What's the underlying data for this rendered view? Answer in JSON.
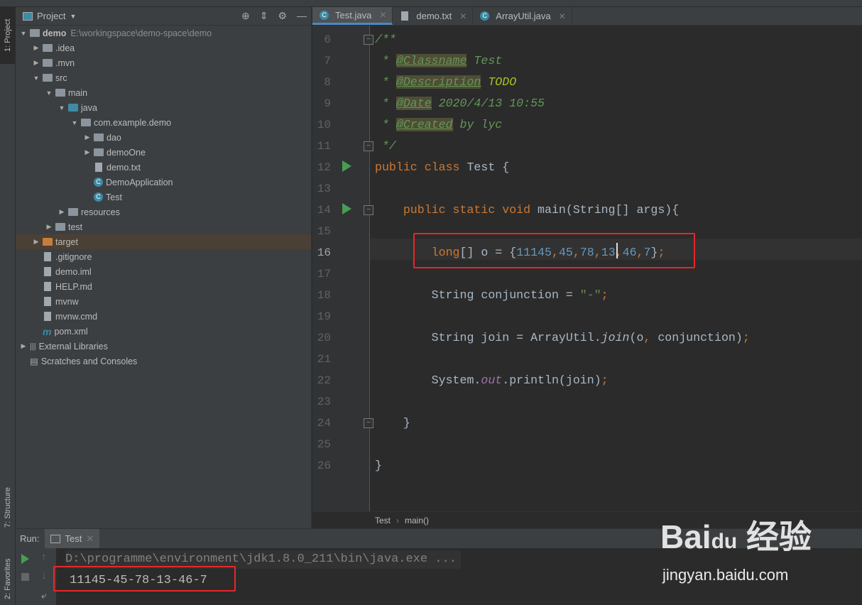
{
  "side_tabs": {
    "project": "1: Project",
    "structure": "7: Structure",
    "favorites": "2: Favorites"
  },
  "project_panel": {
    "title": "Project",
    "tree": [
      {
        "label": "demo",
        "path": "E:\\workingspace\\demo-space\\demo",
        "depth": 0,
        "expanded": true,
        "icon": "module-folder",
        "bold": true
      },
      {
        "label": ".idea",
        "depth": 1,
        "expanded": false,
        "icon": "folder"
      },
      {
        "label": ".mvn",
        "depth": 1,
        "expanded": false,
        "icon": "folder"
      },
      {
        "label": "src",
        "depth": 1,
        "expanded": true,
        "icon": "folder"
      },
      {
        "label": "main",
        "depth": 2,
        "expanded": true,
        "icon": "folder"
      },
      {
        "label": "java",
        "depth": 3,
        "expanded": true,
        "icon": "source-folder"
      },
      {
        "label": "com.example.demo",
        "depth": 4,
        "expanded": true,
        "icon": "package"
      },
      {
        "label": "dao",
        "depth": 5,
        "expanded": false,
        "icon": "package"
      },
      {
        "label": "demoOne",
        "depth": 5,
        "expanded": false,
        "icon": "package"
      },
      {
        "label": "demo.txt",
        "depth": 5,
        "icon": "file"
      },
      {
        "label": "DemoApplication",
        "depth": 5,
        "icon": "class"
      },
      {
        "label": "Test",
        "depth": 5,
        "icon": "class"
      },
      {
        "label": "resources",
        "depth": 3,
        "expanded": false,
        "icon": "folder"
      },
      {
        "label": "test",
        "depth": 2,
        "expanded": false,
        "icon": "folder"
      },
      {
        "label": "target",
        "depth": 1,
        "expanded": false,
        "icon": "excluded-folder",
        "selected": true
      },
      {
        "label": ".gitignore",
        "depth": 1,
        "icon": "file"
      },
      {
        "label": "demo.iml",
        "depth": 1,
        "icon": "file"
      },
      {
        "label": "HELP.md",
        "depth": 1,
        "icon": "file"
      },
      {
        "label": "mvnw",
        "depth": 1,
        "icon": "file"
      },
      {
        "label": "mvnw.cmd",
        "depth": 1,
        "icon": "file"
      },
      {
        "label": "pom.xml",
        "depth": 1,
        "icon": "maven"
      },
      {
        "label": "External Libraries",
        "depth": 0,
        "expanded": false,
        "icon": "library"
      },
      {
        "label": "Scratches and Consoles",
        "depth": 0,
        "icon": "scratch"
      }
    ]
  },
  "editor_tabs": [
    {
      "label": "Test.java",
      "active": true
    },
    {
      "label": "demo.txt"
    },
    {
      "label": "ArrayUtil.java"
    }
  ],
  "code_lines": [
    {
      "n": "6",
      "t": [
        [
          "cmt",
          "/**"
        ]
      ]
    },
    {
      "n": "7",
      "t": [
        [
          "cmt",
          " * "
        ],
        [
          "tag",
          "@Classname"
        ],
        [
          "cmt",
          " Test"
        ]
      ]
    },
    {
      "n": "8",
      "t": [
        [
          "cmt",
          " * "
        ],
        [
          "tag",
          "@Description"
        ],
        [
          "cmt",
          " "
        ],
        [
          "todo",
          "TODO"
        ]
      ]
    },
    {
      "n": "9",
      "t": [
        [
          "cmt",
          " * "
        ],
        [
          "tag",
          "@Date"
        ],
        [
          "cmt",
          " 2020/4/13 10:55"
        ]
      ]
    },
    {
      "n": "10",
      "t": [
        [
          "cmt",
          " * "
        ],
        [
          "tag",
          "@Created"
        ],
        [
          "cmt",
          " by lyc"
        ]
      ]
    },
    {
      "n": "11",
      "t": [
        [
          "cmt",
          " */"
        ]
      ]
    },
    {
      "n": "12",
      "t": [
        [
          "kw",
          "public class "
        ],
        [
          "",
          "Test {"
        ]
      ]
    },
    {
      "n": "13",
      "t": []
    },
    {
      "n": "14",
      "t": [
        [
          "",
          "    "
        ],
        [
          "kw",
          "public static void "
        ],
        [
          "",
          "main(String[] args){"
        ]
      ]
    },
    {
      "n": "15",
      "t": []
    },
    {
      "n": "16",
      "t": [
        [
          "",
          "        "
        ],
        [
          "kw",
          "long"
        ],
        [
          "",
          "[] o = {"
        ],
        [
          "num",
          "11145"
        ],
        [
          "kw",
          ","
        ],
        [
          "num",
          "45"
        ],
        [
          "kw",
          ","
        ],
        [
          "num",
          "78"
        ],
        [
          "kw",
          ","
        ],
        [
          "num",
          "13"
        ],
        [
          "kw",
          ","
        ],
        [
          "num",
          "46"
        ],
        [
          "kw",
          ","
        ],
        [
          "num",
          "7"
        ],
        [
          "",
          "}"
        ],
        [
          "kw",
          ";"
        ]
      ]
    },
    {
      "n": "17",
      "t": []
    },
    {
      "n": "18",
      "t": [
        [
          "",
          "        String conjunction = "
        ],
        [
          "str",
          "\"-\""
        ],
        [
          "kw",
          ";"
        ]
      ]
    },
    {
      "n": "19",
      "t": []
    },
    {
      "n": "20",
      "t": [
        [
          "",
          "        String join = ArrayUtil."
        ],
        [
          "mth",
          "join"
        ],
        [
          "",
          "(o"
        ],
        [
          "kw",
          ", "
        ],
        [
          "",
          "conjunction)"
        ],
        [
          "kw",
          ";"
        ]
      ]
    },
    {
      "n": "21",
      "t": []
    },
    {
      "n": "22",
      "t": [
        [
          "",
          "        System."
        ],
        [
          "stat",
          "out"
        ],
        [
          "",
          "."
        ],
        [
          "",
          "println(join)"
        ],
        [
          "kw",
          ";"
        ]
      ]
    },
    {
      "n": "23",
      "t": []
    },
    {
      "n": "24",
      "t": [
        [
          "",
          "    }"
        ]
      ]
    },
    {
      "n": "25",
      "t": []
    },
    {
      "n": "26",
      "t": [
        [
          "",
          "}"
        ]
      ]
    }
  ],
  "breadcrumb": [
    "Test",
    "main()"
  ],
  "run_panel": {
    "label": "Run:",
    "tab": "Test",
    "command": "D:\\programme\\environment\\jdk1.8.0_211\\bin\\java.exe ...",
    "output": "11145-45-78-13-46-7"
  },
  "watermark": {
    "brand": "Bai du 经验",
    "url": "jingyan.baidu.com"
  },
  "colors": {
    "highlight_box": "#e8262a",
    "accent": "#4a88c7"
  }
}
